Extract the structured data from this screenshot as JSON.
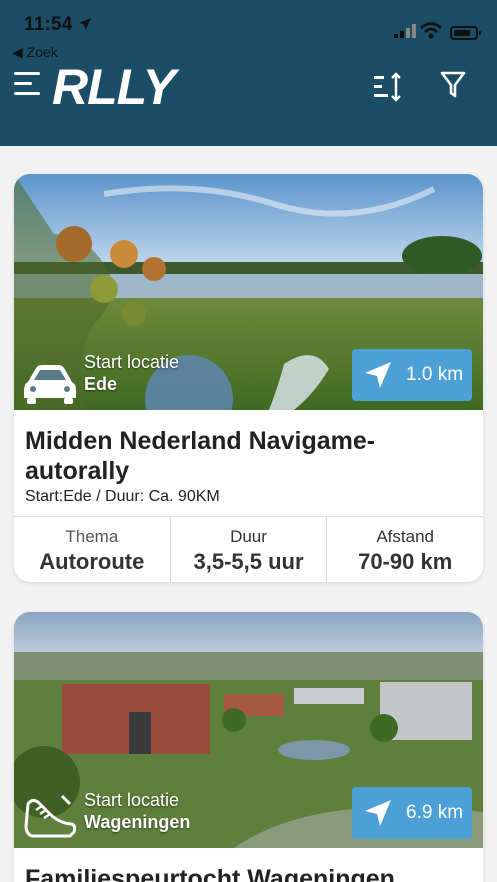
{
  "status": {
    "time": "11:54",
    "back_label": "◀ Zoek"
  },
  "header": {
    "logo": "RLLY"
  },
  "cards": [
    {
      "start_label": "Start locatie",
      "start_location": "Ede",
      "distance": "1.0 km",
      "title": "Midden Nederland Navigame-autorally",
      "subtitle": "Start:Ede / Duur: Ca. 90KM",
      "stats": [
        {
          "label": "Thema",
          "value": "Autoroute"
        },
        {
          "label": "Duur",
          "value": "3,5-5,5 uur"
        },
        {
          "label": "Afstand",
          "value": "70-90 km"
        }
      ]
    },
    {
      "start_label": "Start locatie",
      "start_location": "Wageningen",
      "distance": "6.9 km",
      "title": "Familiespeurtocht Wageningen"
    }
  ],
  "colors": {
    "header": "#1c4d66",
    "badge": "#4ca0d6",
    "background": "#f2f2f2"
  },
  "icons": [
    "location-arrow-icon",
    "signal-icon",
    "wifi-icon",
    "battery-icon",
    "menu-icon",
    "sort-icon",
    "filter-icon",
    "car-icon",
    "walking-shoe-icon",
    "navigation-arrow-icon"
  ]
}
